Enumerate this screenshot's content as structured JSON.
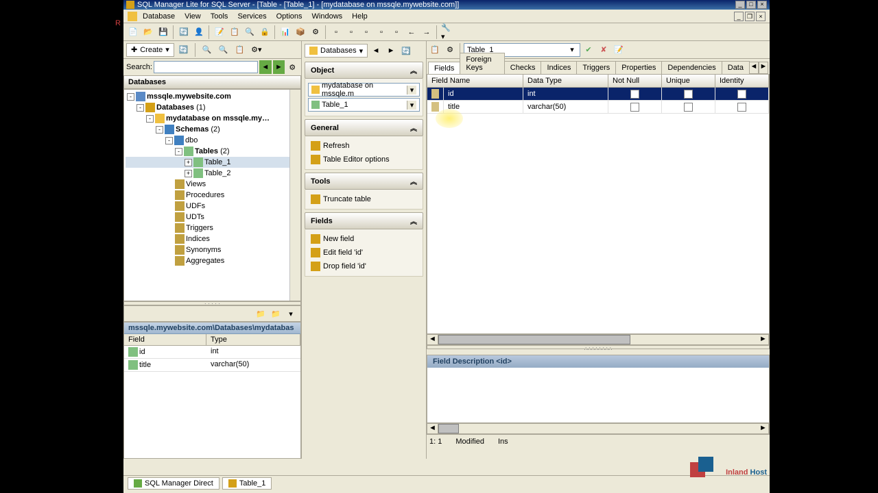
{
  "title": "SQL Manager Lite for SQL Server - [Table - [Table_1] - [mydatabase on mssqle.mywebsite.com]]",
  "menu": [
    "Database",
    "View",
    "Tools",
    "Services",
    "Options",
    "Windows",
    "Help"
  ],
  "toolbar2": {
    "create": "Create"
  },
  "search": {
    "label": "Search:",
    "value": ""
  },
  "dbpanel": {
    "title": "Databases"
  },
  "tree": {
    "server": "mssqle.mywebsite.com",
    "databases_label": "Databases",
    "databases_count": "(1)",
    "db": "mydatabase on mssqle.my…",
    "schemas_label": "Schemas",
    "schemas_count": "(2)",
    "schema": "dbo",
    "tables_label": "Tables",
    "tables_count": "(2)",
    "table1": "Table_1",
    "table2": "Table_2",
    "views": "Views",
    "procedures": "Procedures",
    "udfs": "UDFs",
    "udts": "UDTs",
    "triggers": "Triggers",
    "indices": "Indices",
    "synonyms": "Synonyms",
    "aggregates": "Aggregates"
  },
  "bottom": {
    "path": "mssqle.mywebsite.com\\Databases\\mydatabas",
    "col_field": "Field",
    "col_type": "Type",
    "rows": [
      {
        "field": "id",
        "type": "int"
      },
      {
        "field": "title",
        "type": "varchar(50)"
      }
    ]
  },
  "midToolbar": {
    "databases": "Databases"
  },
  "tasks": {
    "object": {
      "title": "Object",
      "combo1": "mydatabase on mssqle.m",
      "combo2": "Table_1"
    },
    "general": {
      "title": "General",
      "refresh": "Refresh",
      "options": "Table Editor options"
    },
    "tools": {
      "title": "Tools",
      "truncate": "Truncate table"
    },
    "fields": {
      "title": "Fields",
      "new": "New field",
      "edit": "Edit field 'id'",
      "drop": "Drop field 'id'"
    }
  },
  "rightToolbar": {
    "table_combo": "Table_1"
  },
  "tabs": [
    "Fields",
    "Foreign Keys",
    "Checks",
    "Indices",
    "Triggers",
    "Properties",
    "Dependencies",
    "Data"
  ],
  "grid": {
    "headers": {
      "name": "Field Name",
      "type": "Data Type",
      "notnull": "Not Null",
      "unique": "Unique",
      "identity": "Identity"
    },
    "rows": [
      {
        "name": "id",
        "type": "int",
        "notnull": true,
        "unique": false,
        "identity": true
      },
      {
        "name": "title",
        "type": "varchar(50)",
        "notnull": false,
        "unique": false,
        "identity": false
      }
    ]
  },
  "desc": {
    "title": "Field Description <id>"
  },
  "status": {
    "pos": "1:",
    "col": "1",
    "mode": "Modified",
    "ins": "Ins"
  },
  "bottomTabs": {
    "t1": "SQL Manager Direct",
    "t2": "Table_1"
  },
  "watermark": {
    "t1": "Inland ",
    "t2": "Host"
  },
  "leftRed": "R"
}
